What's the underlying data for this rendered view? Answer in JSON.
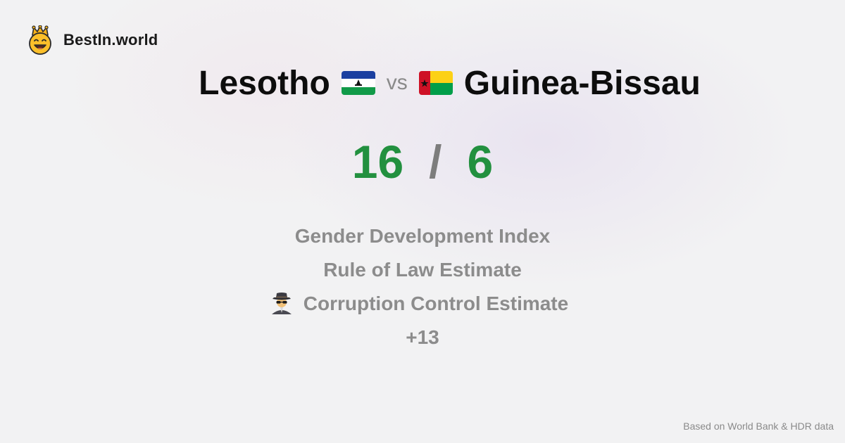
{
  "brand": {
    "name": "BestIn.world",
    "logo_icon": "smiling-crown-face-icon"
  },
  "comparison": {
    "country_a": {
      "name": "Lesotho",
      "flag_icon": "lesotho-flag-icon"
    },
    "vs_label": "vs",
    "country_b": {
      "name": "Guinea-Bissau",
      "flag_icon": "guinea-bissau-flag-icon"
    }
  },
  "scores": {
    "a": "16",
    "separator": "/",
    "b": "6",
    "color": "#22903f"
  },
  "metrics": [
    {
      "label": "Gender Development Index"
    },
    {
      "label": "Rule of Law Estimate"
    },
    {
      "label": "Corruption Control Estimate",
      "icon": "spy-detective-icon"
    },
    {
      "label": "+13"
    }
  ],
  "footer": {
    "source": "Based on World Bank & HDR data"
  }
}
